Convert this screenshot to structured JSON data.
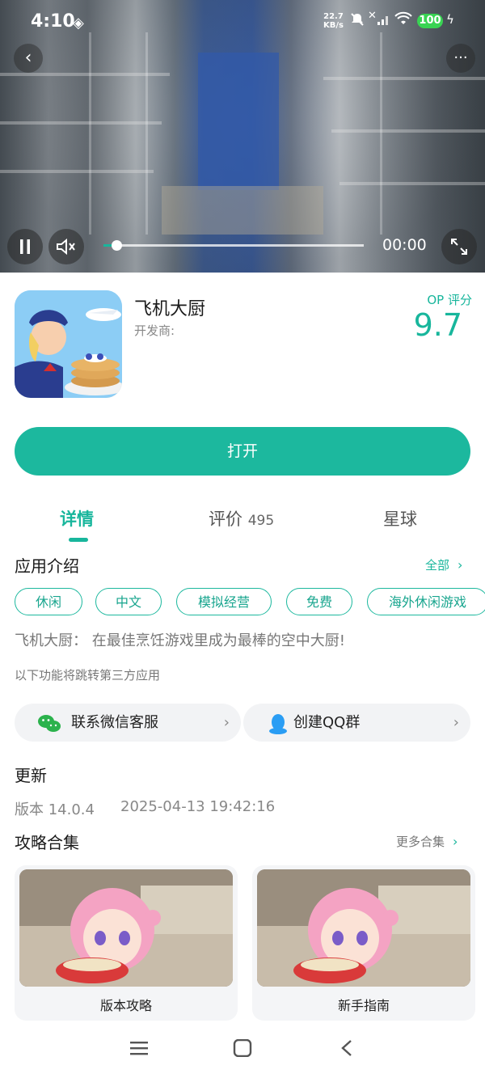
{
  "status": {
    "time": "4:10",
    "net_speed_value": "22.7",
    "net_speed_unit": "KB/s",
    "battery": "100"
  },
  "video": {
    "time_display": "00:00",
    "progress": 0.05
  },
  "app": {
    "name": "飞机大厨",
    "developer_label": "开发商:",
    "score_label": "OP 评分",
    "score": "9.7",
    "open_label": "打开"
  },
  "tabs": {
    "details": "详情",
    "reviews": "评价",
    "reviews_count": "495",
    "planet": "星球"
  },
  "intro": {
    "title": "应用介绍",
    "all_label": "全部",
    "tags": [
      "休闲",
      "中文",
      "模拟经营",
      "免费",
      "海外休闲游戏"
    ],
    "description": "飞机大厨： 在最佳烹饪游戏里成为最棒的空中大厨!",
    "third_party_note": "以下功能将跳转第三方应用"
  },
  "links": {
    "wechat": "联系微信客服",
    "qq": "创建QQ群"
  },
  "update": {
    "title": "更新",
    "version": "版本 14.0.4",
    "date": "2025-04-13 19:42:16"
  },
  "guides": {
    "title": "攻略合集",
    "more_label": "更多合集",
    "cards": [
      "版本攻略",
      "新手指南"
    ]
  },
  "colors": {
    "accent": "#1cb89e"
  }
}
